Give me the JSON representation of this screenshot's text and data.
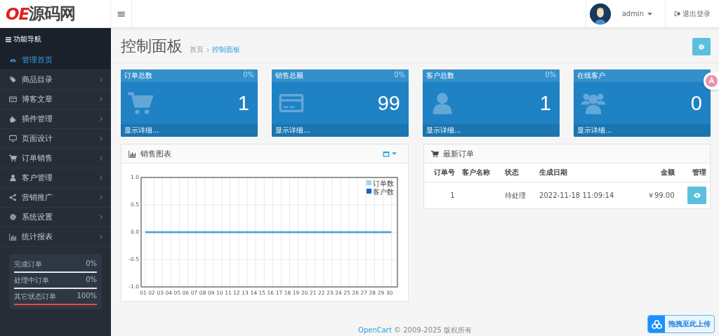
{
  "header": {
    "logo": "OE源码网",
    "menu_toggle": "≡",
    "user": "admin",
    "logout": "退出登录"
  },
  "sidebar": {
    "title": "功能导航",
    "items": [
      {
        "label": "管理首页",
        "kind": "dashboard",
        "selected": true,
        "expandable": false
      },
      {
        "label": "商品目录",
        "kind": "tag",
        "selected": false,
        "expandable": true
      },
      {
        "label": "博客文章",
        "kind": "card",
        "selected": false,
        "expandable": true
      },
      {
        "label": "插件管理",
        "kind": "puzzle",
        "selected": false,
        "expandable": true
      },
      {
        "label": "页面设计",
        "kind": "monitor",
        "selected": false,
        "expandable": true
      },
      {
        "label": "订单销售",
        "kind": "cart",
        "selected": false,
        "expandable": true
      },
      {
        "label": "客户管理",
        "kind": "user",
        "selected": false,
        "expandable": true
      },
      {
        "label": "营销推广",
        "kind": "share",
        "selected": false,
        "expandable": true
      },
      {
        "label": "系统设置",
        "kind": "gear",
        "selected": false,
        "expandable": true
      },
      {
        "label": "统计报表",
        "kind": "bars",
        "selected": false,
        "expandable": true
      }
    ],
    "progress": [
      {
        "label": "完成订单",
        "reading": "0%",
        "level": 0
      },
      {
        "label": "处理中订单",
        "reading": "0%",
        "level": 0
      },
      {
        "label": "其它状态订单",
        "reading": "100%",
        "level": 1
      }
    ]
  },
  "page": {
    "title": "控制面板",
    "breadcrumb": [
      {
        "label": "首页",
        "selected": false
      },
      {
        "label": "控制面板",
        "selected": true
      }
    ]
  },
  "stats": [
    {
      "title": "订单总数",
      "percent": "0%",
      "value": "1",
      "kind": "cart",
      "link": "显示详细..."
    },
    {
      "title": "销售总额",
      "percent": "0%",
      "value": "99",
      "kind": "card",
      "link": "显示详细..."
    },
    {
      "title": "客户总数",
      "percent": "0%",
      "value": "1",
      "kind": "user",
      "link": "显示详细..."
    },
    {
      "title": "在线客户",
      "value": "0",
      "kind": "users",
      "link": "显示详细..."
    }
  ],
  "sales_chart": {
    "title": "销售图表",
    "chart_data": {
      "type": "line",
      "legend": true,
      "grid": true,
      "x": [
        "01",
        "02",
        "03",
        "04",
        "05",
        "06",
        "07",
        "08",
        "09",
        "10",
        "11",
        "12",
        "13",
        "14",
        "15",
        "16",
        "17",
        "18",
        "19",
        "20",
        "21",
        "22",
        "23",
        "24",
        "25",
        "26",
        "27",
        "28",
        "29",
        "30"
      ],
      "ylim": [
        -1,
        1
      ],
      "yticks": [
        {
          "value": 1,
          "label": "1.0"
        },
        {
          "value": 0.5,
          "label": "0.5"
        },
        {
          "value": 0,
          "label": "0.0"
        },
        {
          "value": -0.5,
          "label": "-0.5"
        },
        {
          "value": -1,
          "label": "-1.0"
        }
      ],
      "series": [
        {
          "name": "订单数",
          "color": "#9fd6f2",
          "values": [
            0,
            0,
            0,
            0,
            0,
            0,
            0,
            0,
            0,
            0,
            0,
            0,
            0,
            0,
            0,
            0,
            0,
            0,
            0,
            0,
            0,
            0,
            0,
            0,
            0,
            0,
            0,
            0,
            0,
            0
          ]
        },
        {
          "name": "客户数",
          "color": "#1065c8",
          "values": [
            0,
            0,
            0,
            0,
            0,
            0,
            0,
            0,
            0,
            0,
            0,
            0,
            0,
            0,
            0,
            0,
            0,
            0,
            0,
            0,
            0,
            0,
            0,
            0,
            0,
            0,
            0,
            0,
            0,
            0
          ]
        }
      ]
    }
  },
  "latest_orders": {
    "title": "最新订单",
    "columns": [
      "订单号",
      "客户名称",
      "状态",
      "生成日期",
      "金额",
      "管理"
    ],
    "rows": [
      {
        "order_id": "1",
        "status": "待处理",
        "date": "2022-11-18 11:09:14",
        "total": "￥99.00"
      }
    ]
  },
  "upload_widget": {
    "label": "拖拽至此上传"
  },
  "footer": {
    "link": "OpenCart",
    "text": "© 2009-2025 版权所有"
  }
}
